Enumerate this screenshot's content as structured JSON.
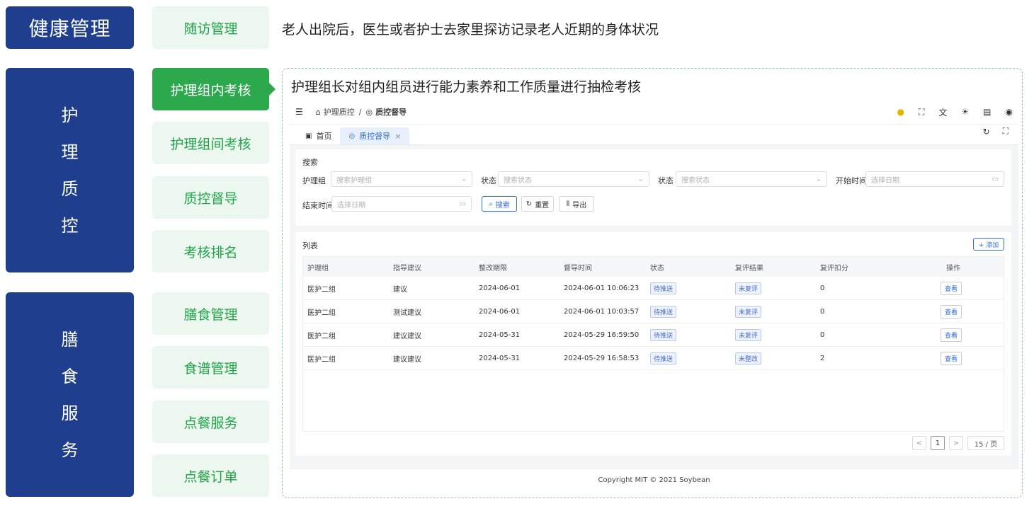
{
  "left": {
    "cat_health": "健康管理",
    "cat_nursing": [
      "护",
      "理",
      "质",
      "控"
    ],
    "cat_meal": [
      "膳",
      "食",
      "服",
      "务"
    ]
  },
  "subs": {
    "followup": "随访管理",
    "group_internal": "护理组内考核",
    "group_between": "护理组间考核",
    "qc": "质控督导",
    "ranking": "考核排名",
    "meal_mgmt": "膳食管理",
    "recipe_mgmt": "食谱管理",
    "order_service": "点餐服务",
    "order_list": "点餐订单"
  },
  "descriptions": {
    "followup": "老人出院后，医生或者护士去家里探访记录老人近期的身体状况",
    "internal": "护理组长对组内组员进行能力素养和工作质量进行抽检考核"
  },
  "app": {
    "breadcrumb": {
      "level1": "护理质控",
      "sep": "/",
      "level2": "质控督导"
    },
    "tabs": {
      "home": "首页",
      "current": "质控督导",
      "close": "×"
    },
    "search": {
      "title": "搜索",
      "group_label": "护理组",
      "group_placeholder": "搜索护理组",
      "status_label1": "状态",
      "status_placeholder1": "搜索状态",
      "status_label2": "状态",
      "status_placeholder2": "搜索状态",
      "start_label": "开始时间",
      "start_placeholder": "选择日期",
      "end_label": "结束时间",
      "end_placeholder": "选择日期",
      "search_btn": "搜索",
      "reset_btn": "重置",
      "export_btn": "导出"
    },
    "list": {
      "title": "列表",
      "add_btn": "+ 添加",
      "columns": [
        "护理组",
        "指导建议",
        "整改期限",
        "督导时间",
        "状态",
        "复评结果",
        "复评扣分",
        "操作"
      ],
      "rows": [
        {
          "group": "医护二组",
          "advice": "建议",
          "deadline": "2024-06-01",
          "time": "2024-06-01 10:06:23",
          "status": "待推送",
          "result": "未复评",
          "score": "0",
          "action": "查看"
        },
        {
          "group": "医护二组",
          "advice": "测试建议",
          "deadline": "2024-06-01",
          "time": "2024-06-01 10:03:57",
          "status": "待推送",
          "result": "未复评",
          "score": "0",
          "action": "查看"
        },
        {
          "group": "医护二组",
          "advice": "建议建议",
          "deadline": "2024-05-31",
          "time": "2024-05-29 16:59:50",
          "status": "待推送",
          "result": "未复评",
          "score": "0",
          "action": "查看"
        },
        {
          "group": "医护二组",
          "advice": "建议建议",
          "deadline": "2024-05-31",
          "time": "2024-05-29 16:58:53",
          "status": "待推送",
          "result": "未整改",
          "score": "2",
          "action": "查看"
        }
      ]
    },
    "pagination": {
      "prev": "<",
      "page": "1",
      "next": ">",
      "size": "15 / 页"
    },
    "footer": "Copyright MIT © 2021 Soybean"
  },
  "colors": {
    "navy": "#1f3f8e",
    "green": "#2ca84d",
    "light_green": "#ecf8ef",
    "primary": "#2d6be0"
  }
}
